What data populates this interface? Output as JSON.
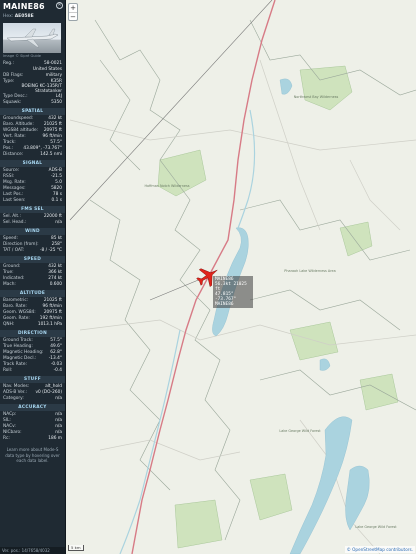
{
  "aircraft": {
    "callsign": "MAINE86",
    "hex_label": "Hex:",
    "hex": "AE058E",
    "photo_credit": "Image © Sipré Guide",
    "reg_label": "Reg.:",
    "reg": "58-0021",
    "country": "United States",
    "db_flags_label": "DB Flags:",
    "db_flags": "military",
    "type_label": "Type:",
    "type": "K35R",
    "type_desc": "BOEING KC-135R/T Stratotanker",
    "type_desc_label": "Type Desc.:",
    "type_desc_value": "L4J",
    "squawk_label": "Squawk:",
    "squawk": "5350"
  },
  "sections": {
    "spatial": "SPATIAL",
    "signal": "SIGNAL",
    "fms": "FMS SEL",
    "wind": "WIND",
    "speed": "SPEED",
    "altitude": "ALTITUDE",
    "direction": "DIRECTION",
    "stuff": "STUFF",
    "accuracy": "ACCURACY"
  },
  "spatial": [
    {
      "k": "Groundspeed:",
      "v": "432 kt"
    },
    {
      "k": "Baro. Altitude:",
      "v": "21025 ft"
    },
    {
      "k": "WGS84 altitude:",
      "v": "20975 ft"
    },
    {
      "k": "Vert. Rate:",
      "v": "96 ft/min"
    },
    {
      "k": "Track:",
      "v": "57.5°"
    },
    {
      "k": "Pos.:",
      "v": "43.809°, -73.767°"
    },
    {
      "k": "Distance:",
      "v": "142.5 nmi"
    }
  ],
  "signal": [
    {
      "k": "Source:",
      "v": "ADS-B"
    },
    {
      "k": "RSSI:",
      "v": "-21.5"
    },
    {
      "k": "Msg. Rate:",
      "v": "5.0"
    },
    {
      "k": "Messages:",
      "v": "5820"
    },
    {
      "k": "Last Pos.:",
      "v": "78 s"
    },
    {
      "k": "Last Seen:",
      "v": "0.1 s"
    }
  ],
  "fms": [
    {
      "k": "Sel. Alt.:",
      "v": "22000 ft"
    },
    {
      "k": "Sel. Head.:",
      "v": "n/a"
    }
  ],
  "wind": [
    {
      "k": "Speed:",
      "v": "85 kt"
    },
    {
      "k": "Direction (from):",
      "v": "258°"
    },
    {
      "k": "TAT / OAT:",
      "v": "-8 / -25 °C"
    }
  ],
  "speed": [
    {
      "k": "Ground:",
      "v": "432 kt"
    },
    {
      "k": "True:",
      "v": "366 kt"
    },
    {
      "k": "Indicated:",
      "v": "274 kt"
    },
    {
      "k": "Mach:",
      "v": "0.600"
    }
  ],
  "altitude": [
    {
      "k": "Barometric:",
      "v": "21025 ft"
    },
    {
      "k": "Baro. Rate:",
      "v": "96 ft/min"
    },
    {
      "k": "Geom. WGS84:",
      "v": "20975 ft"
    },
    {
      "k": "Geom. Rate:",
      "v": "192 ft/min"
    },
    {
      "k": "QNH:",
      "v": "1013.1 hPa"
    }
  ],
  "direction": [
    {
      "k": "Ground Track:",
      "v": "57.5°"
    },
    {
      "k": "True Heading:",
      "v": "49.6°"
    },
    {
      "k": "Magnetic Heading:",
      "v": "62.8°"
    },
    {
      "k": "Magnetic Decl.:",
      "v": "-13.4°"
    },
    {
      "k": "Track Rate:",
      "v": "-0.03"
    },
    {
      "k": "Roll:",
      "v": "-0.4"
    }
  ],
  "stuff": [
    {
      "k": "Nav. Modes:",
      "v": "alt_hold"
    },
    {
      "k": "ADS-B Ver.:",
      "v": "v0 (DO-260)"
    },
    {
      "k": "Category:",
      "v": "n/a"
    }
  ],
  "accuracy": [
    {
      "k": "NACp:",
      "v": "n/a"
    },
    {
      "k": "SIL:",
      "v": "n/a"
    },
    {
      "k": "NACv:",
      "v": "n/a"
    },
    {
      "k": "NICbaro:",
      "v": "n/a"
    },
    {
      "k": "Rc:",
      "v": "186 m"
    }
  ],
  "learn_more": "Learn more about Mode-S data type by hovering over each data label.",
  "bottom_bar": "Ver. pos.: 14/7658/4032",
  "map": {
    "plane_label_lines": [
      "MAINE86",
      "56.3kt 21025 ft",
      "47.815° -73.767°",
      "MAINE86"
    ],
    "places": [
      {
        "name": "Hoffman Notch Wilderness"
      },
      {
        "name": "Northwest Bay Wilderness"
      },
      {
        "name": "Pharaoh Lake Wilderness Area"
      },
      {
        "name": "Lake George Wild Forest"
      },
      {
        "name": "Lake George Wild Forest"
      }
    ],
    "attribution": "© OpenStreetMap contributors.",
    "attribution_link": "OpenStreetMap",
    "scale": "5 km",
    "zoom_in": "+",
    "zoom_out": "−",
    "colors": {
      "plane": "#e0231b",
      "route": "#d77b86",
      "water": "#aad3df",
      "land": "#eef0e8"
    }
  }
}
